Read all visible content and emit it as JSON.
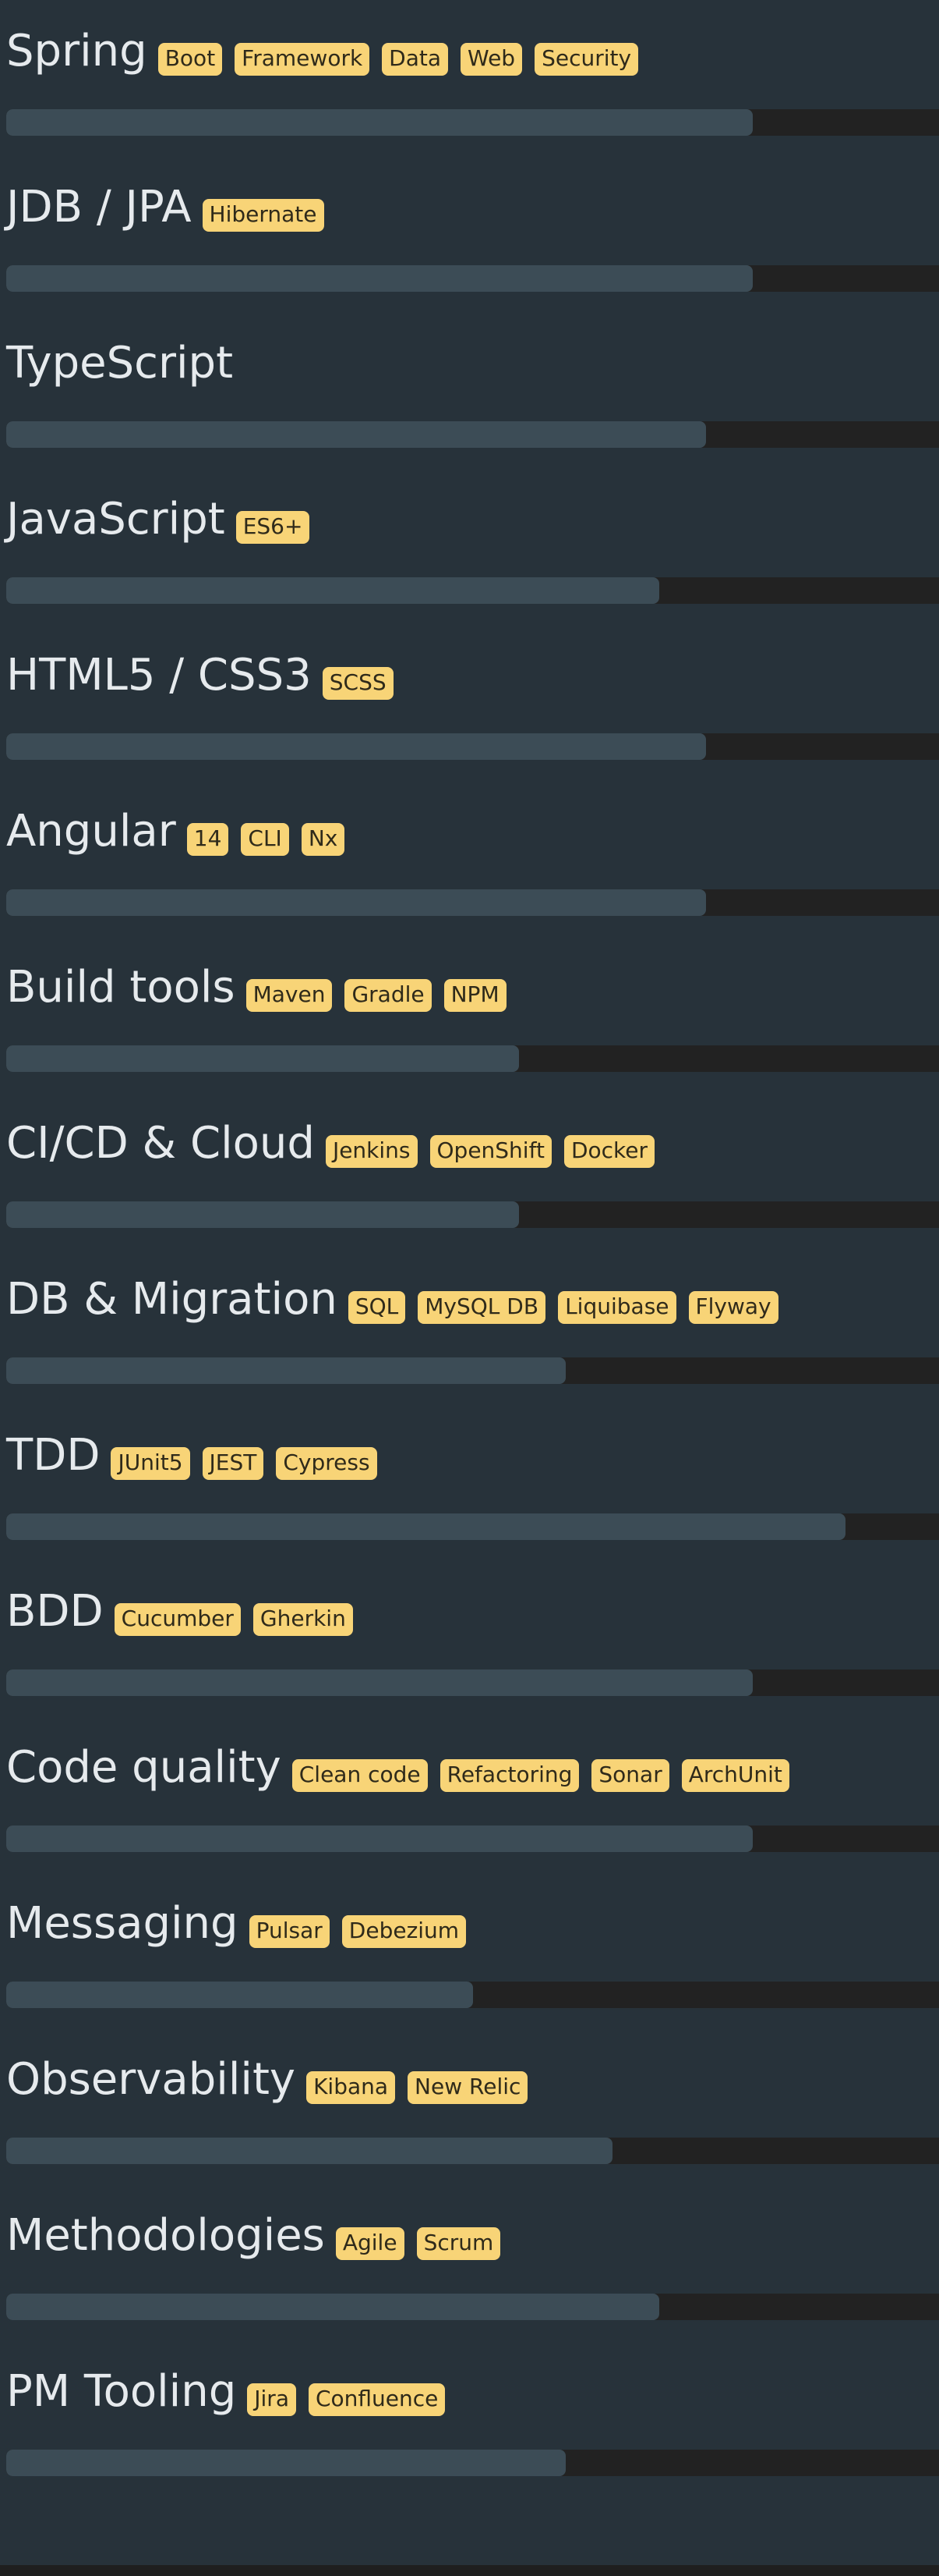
{
  "skills": [
    {
      "name": "Spring",
      "tags": [
        "Boot",
        "Framework",
        "Data",
        "Web",
        "Security"
      ],
      "level": 0.8
    },
    {
      "name": "JDB / JPA",
      "tags": [
        "Hibernate"
      ],
      "level": 0.8
    },
    {
      "name": "TypeScript",
      "tags": [],
      "level": 0.75
    },
    {
      "name": "JavaScript",
      "tags": [
        "ES6+"
      ],
      "level": 0.7
    },
    {
      "name": "HTML5 / CSS3",
      "tags": [
        "SCSS"
      ],
      "level": 0.75
    },
    {
      "name": "Angular",
      "tags": [
        "14",
        "CLI",
        "Nx"
      ],
      "level": 0.75
    },
    {
      "name": "Build tools",
      "tags": [
        "Maven",
        "Gradle",
        "NPM"
      ],
      "level": 0.55
    },
    {
      "name": "CI/CD & Cloud",
      "tags": [
        "Jenkins",
        "OpenShift",
        "Docker"
      ],
      "level": 0.55
    },
    {
      "name": "DB & Migration",
      "tags": [
        "SQL",
        "MySQL DB",
        "Liquibase",
        "Flyway"
      ],
      "level": 0.6
    },
    {
      "name": "TDD",
      "tags": [
        "JUnit5",
        "JEST",
        "Cypress"
      ],
      "level": 0.9
    },
    {
      "name": "BDD",
      "tags": [
        "Cucumber",
        "Gherkin"
      ],
      "level": 0.8
    },
    {
      "name": "Code quality",
      "tags": [
        "Clean code",
        "Refactoring",
        "Sonar",
        "ArchUnit"
      ],
      "level": 0.8
    },
    {
      "name": "Messaging",
      "tags": [
        "Pulsar",
        "Debezium"
      ],
      "level": 0.5
    },
    {
      "name": "Observability",
      "tags": [
        "Kibana",
        "New Relic"
      ],
      "level": 0.65
    },
    {
      "name": "Methodologies",
      "tags": [
        "Agile",
        "Scrum"
      ],
      "level": 0.7
    },
    {
      "name": "PM Tooling",
      "tags": [
        "Jira",
        "Confluence"
      ],
      "level": 0.6
    }
  ],
  "colors": {
    "background": "#27323a",
    "tag": "#f8d477",
    "bar_fill": "#3c4c56",
    "bar_track": "#222222"
  }
}
